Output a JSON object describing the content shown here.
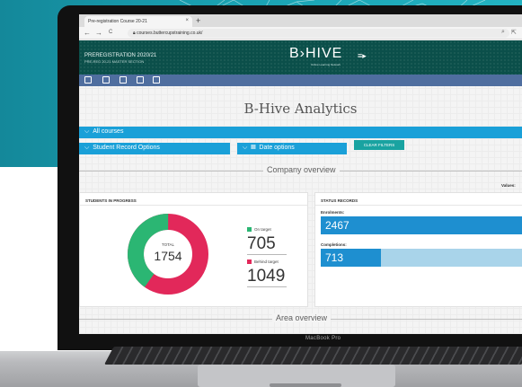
{
  "browser": {
    "tab_title": "Pre-registration Course 20-21",
    "tab_close": "×",
    "new_tab": "+",
    "back": "←",
    "forward": "→",
    "reload": "C",
    "url": "courses.buttercupstraining.co.uk/"
  },
  "header": {
    "course_title": "PREREGISTRATION 2020/21",
    "course_subtitle": "PRE-REG 20-21 MASTER SECTION",
    "logo_text": "B›HIVE",
    "logo_tagline": "Online Learning Network"
  },
  "page": {
    "title": "B-Hive Analytics",
    "all_courses": "All courses",
    "student_record_options": "Student Record Options",
    "date_options": "Date options",
    "clear_filters": "CLEAR FILTERS",
    "company_overview": "Company overview",
    "values_label": "Values:",
    "area_overview": "Area overview"
  },
  "students_card": {
    "title": "STUDENTS IN PROGRESS",
    "total_label": "TOTAL",
    "total": "1754",
    "on_target_label": "On target",
    "on_target": "705",
    "behind_target_label": "Behind target",
    "behind_target": "1049",
    "colors": {
      "on_target": "#2bb673",
      "behind_target": "#e2285a"
    }
  },
  "status_card": {
    "title": "STATUS RECORDS",
    "enrolments_label": "Enrolments:",
    "enrolments": "2467",
    "completions_label": "Completions:",
    "completions": "713",
    "completions_fraction": 0.289
  },
  "laptop": {
    "model": "MacBook Pro"
  },
  "colors": {
    "accent_blue": "#1aa0d8",
    "header_green": "#0b4f4a",
    "icon_bar": "#4f6e9f",
    "clear_button": "#19a3a1"
  }
}
